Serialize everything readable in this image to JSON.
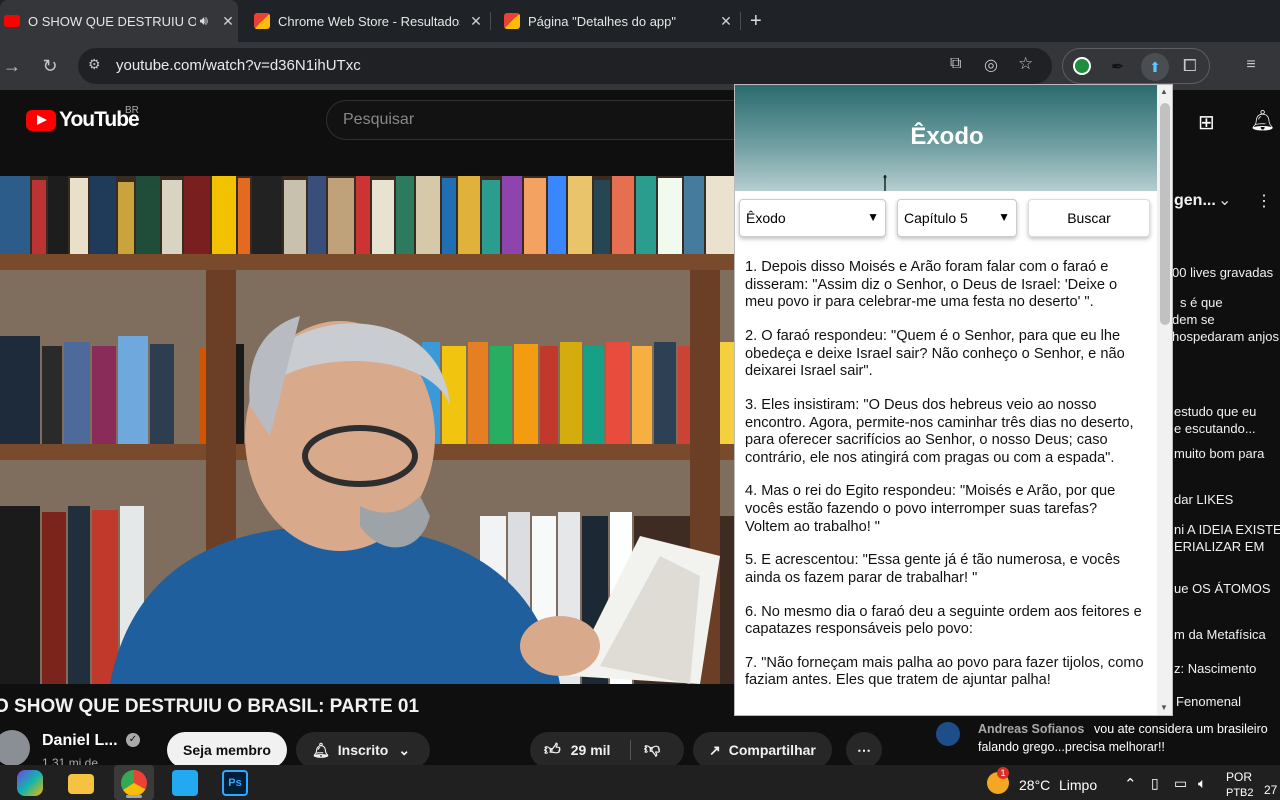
{
  "tabs": [
    {
      "title": "O SHOW QUE DESTRUIU O BRASIL",
      "favicon_color": "#ff0000",
      "active": true
    },
    {
      "title": "Chrome Web Store - Resultados",
      "favicon_color": "#e94235",
      "active": false
    },
    {
      "title": "Página \"Detalhes do app\"",
      "favicon_color": "#e94235",
      "active": false
    }
  ],
  "toolbar": {
    "url": "youtube.com/watch?v=d36N1ihUTxc"
  },
  "youtube": {
    "logo_text": "YouTube",
    "country_code": "BR",
    "search_placeholder": "Pesquisar",
    "video_title": "O SHOW QUE DESTRUIU O BRASIL: PARTE 01",
    "channel_name": "Daniel L...",
    "subscribers": "1,31 mi de",
    "join_label": "Seja membro",
    "subscribed_label": "Inscrito",
    "likes": "29 mil",
    "share_label": "Compartilhar",
    "right_column": {
      "filter_label": "gen...",
      "lines": [
        "00 lives gravadas",
        "s é que",
        "dem se",
        "hospedaram anjos",
        "estudo que eu",
        "e escutando...",
        "muito bom para",
        "dar LIKES",
        "ni   A IDEIA EXISTE",
        "ERIALIZAR EM",
        "ue   OS ÁTOMOS",
        "m da Metafísica",
        "z: Nascimento",
        "Fenomenal"
      ],
      "chat_author": "Andreas Sofianos",
      "chat_message_line1": "vou ate considera um brasileiro",
      "chat_message_line2": "falando grego...precisa melhorar!!"
    }
  },
  "popup": {
    "title": "Êxodo",
    "book_select": "Êxodo",
    "chapter_select": "Capítulo 5",
    "search_button": "Buscar",
    "verses": [
      "1. Depois disso Moisés e Arão foram falar com o faraó e disseram: \"Assim diz o Senhor, o Deus de Israel: 'Deixe o meu povo ir para celebrar-me uma festa no deserto' \".",
      "2. O faraó respondeu: \"Quem é o Senhor, para que eu lhe obedeça e deixe Israel sair? Não conheço o Senhor, e não deixarei Israel sair\".",
      "3. Eles insistiram: \"O Deus dos hebreus veio ao nosso encontro. Agora, permite-nos caminhar três dias no deserto, para oferecer sacrifícios ao Senhor, o nosso Deus; caso contrário, ele nos atingirá com pragas ou com a espada\".",
      "4. Mas o rei do Egito respondeu: \"Moisés e Arão, por que vocês estão fazendo o povo interromper suas tarefas? Voltem ao trabalho! \"",
      "5. E acrescentou: \"Essa gente já é tão numerosa, e vocês ainda os fazem parar de trabalhar! \"",
      "6. No mesmo dia o faraó deu a seguinte ordem aos feitores e capatazes responsáveis pelo povo:",
      "7. \"Não forneçam mais palha ao povo para fazer tijolos, como faziam antes. Eles que tratem de ajuntar palha!"
    ]
  },
  "taskbar": {
    "weather_temp": "28°C",
    "weather_desc": "Limpo",
    "weather_badge": "1",
    "lang_top": "POR",
    "lang_bottom": "PTB2",
    "clock_partial": "27"
  },
  "colors": {
    "youtube_red": "#ff0000",
    "popup_header": "#2a6b6e",
    "browser_dark": "#35363a"
  }
}
